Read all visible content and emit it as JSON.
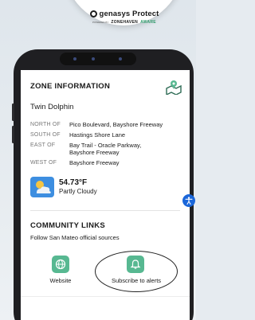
{
  "brand": {
    "name": "genasys Protect",
    "powered_by": "POWERED BY",
    "zonehaven": "ZONEHAVEN",
    "aware": "AWARE"
  },
  "zone": {
    "section_title": "ZONE INFORMATION",
    "zone_name": "Twin Dolphin",
    "boundaries": [
      {
        "label": "NORTH OF",
        "value": "Pico Boulevard, Bayshore Freeway"
      },
      {
        "label": "SOUTH OF",
        "value": "Hastings Shore Lane"
      },
      {
        "label": "EAST OF",
        "value": "Bay Trail - Oracle Parkway, Bayshore Freeway"
      },
      {
        "label": "WEST OF",
        "value": "Bayshore Freeway"
      }
    ]
  },
  "weather": {
    "icon": "partly-cloudy-icon",
    "temperature": "54.73°F",
    "condition": "Partly Cloudy"
  },
  "community": {
    "section_title": "COMMUNITY LINKS",
    "subtitle": "Follow San Mateo official sources",
    "links": [
      {
        "label": "Website",
        "icon": "globe-icon"
      },
      {
        "label": "Subscribe to alerts",
        "icon": "bell-icon"
      }
    ]
  },
  "colors": {
    "accent": "#57b891",
    "accessibility": "#1a66d9",
    "phone_frame": "#1f1f22"
  }
}
